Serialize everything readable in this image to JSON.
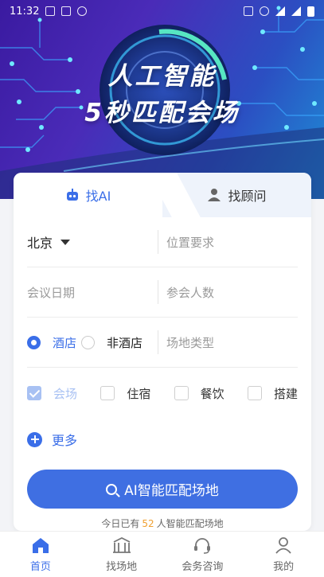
{
  "status_bar": {
    "time": "11:32"
  },
  "hero": {
    "line1": "人工智能",
    "line2": "5秒匹配会场"
  },
  "tabs": [
    {
      "label": "找AI",
      "icon": "robot-icon",
      "active": true
    },
    {
      "label": "找顾问",
      "icon": "person-icon",
      "active": false
    }
  ],
  "form": {
    "city": "北京",
    "location_placeholder": "位置要求",
    "date_placeholder": "会议日期",
    "attendees_placeholder": "参会人数",
    "venue_options": [
      {
        "label": "酒店",
        "selected": true
      },
      {
        "label": "非酒店",
        "selected": false
      }
    ],
    "venue_type_placeholder": "场地类型",
    "services": [
      {
        "label": "会场",
        "checked": true
      },
      {
        "label": "住宿",
        "checked": false
      },
      {
        "label": "餐饮",
        "checked": false
      },
      {
        "label": "搭建",
        "checked": false
      }
    ],
    "more_label": "更多",
    "submit_label": "AI智能匹配场地"
  },
  "stat": {
    "prefix": "今日已有",
    "count": "52",
    "suffix": "人智能匹配场地"
  },
  "nav": [
    {
      "label": "首页",
      "icon": "home-icon",
      "active": true
    },
    {
      "label": "找场地",
      "icon": "building-icon",
      "active": false
    },
    {
      "label": "会务咨询",
      "icon": "headset-icon",
      "active": false
    },
    {
      "label": "我的",
      "icon": "user-icon",
      "active": false
    }
  ],
  "colors": {
    "accent": "#3a6ee8",
    "highlight": "#f0a030"
  }
}
